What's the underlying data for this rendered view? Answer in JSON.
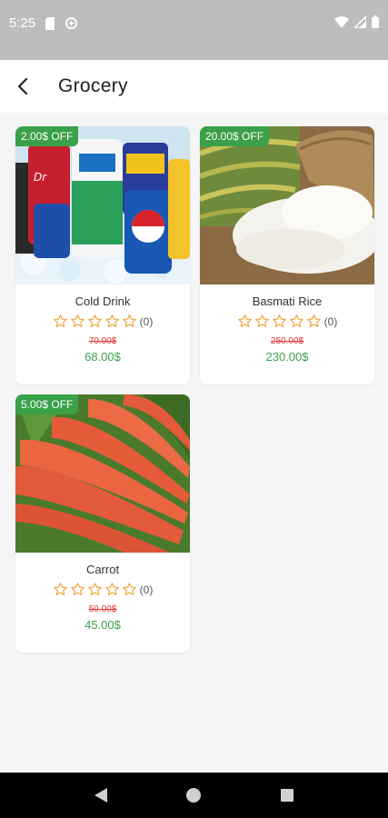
{
  "status_bar": {
    "time": "5:25",
    "icons": [
      "sd-card-icon",
      "data-saver-icon",
      "wifi-icon",
      "signal-icon",
      "battery-icon"
    ]
  },
  "app_bar": {
    "back_icon": "arrow-back-icon",
    "title": "Grocery"
  },
  "colors": {
    "accent": "#3aa04a",
    "old_price": "#e53935",
    "star": "#f0a035",
    "status_bar": "#bdbdbd"
  },
  "products": [
    {
      "discount": "2.00$ OFF",
      "name": "Cold Drink",
      "rating_count": "(0)",
      "stars": 0,
      "old_price": "70.00$",
      "new_price": "68.00$"
    },
    {
      "discount": "20.00$ OFF",
      "name": "Basmati Rice",
      "rating_count": "(0)",
      "stars": 0,
      "old_price": "250.00$",
      "new_price": "230.00$"
    },
    {
      "discount": "5.00$ OFF",
      "name": "Carrot",
      "rating_count": "(0)",
      "stars": 0,
      "old_price": "50.00$",
      "new_price": "45.00$"
    }
  ],
  "nav_bar": {
    "buttons": [
      "back-triangle-icon",
      "home-circle-icon",
      "recents-square-icon"
    ]
  }
}
